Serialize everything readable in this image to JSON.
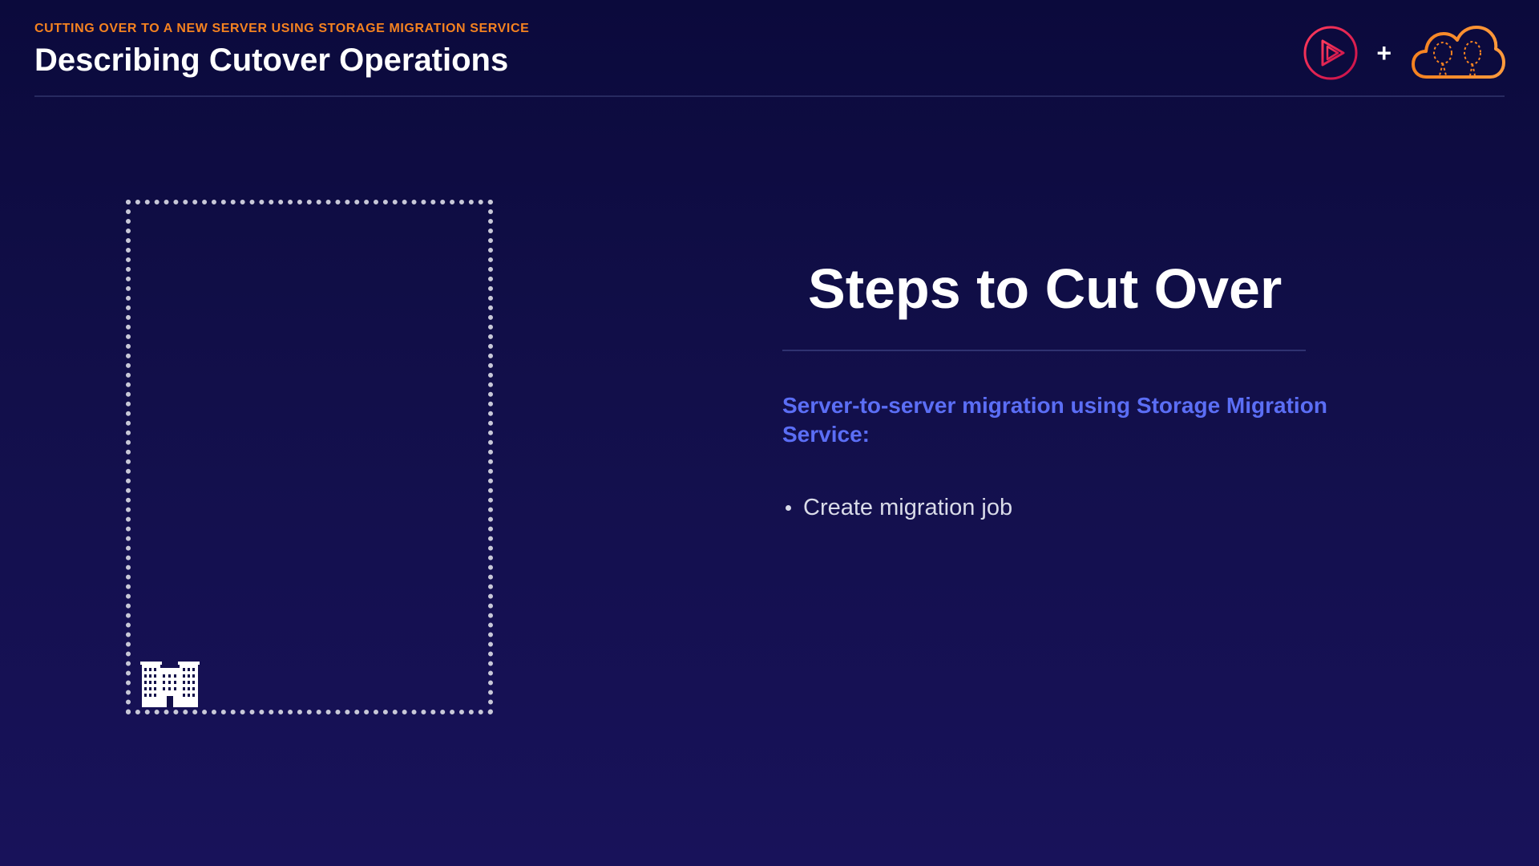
{
  "header": {
    "kicker": "CUTTING OVER TO A NEW SERVER USING STORAGE MIGRATION SERVICE",
    "title": "Describing Cutover Operations"
  },
  "brand": {
    "left_logo": "play-circle-icon",
    "plus": "+",
    "right_logo": "cloud-icon"
  },
  "diagram": {
    "placeholder": "dotted-rectangle",
    "icon": "building-icon"
  },
  "content": {
    "heading": "Steps to Cut Over",
    "subheading": "Server-to-server migration using Storage Migration Service:",
    "bullets": [
      "Create migration job"
    ]
  },
  "colors": {
    "accent_orange": "#f58220",
    "accent_blue": "#5b6ef5",
    "brand_red": "#e0174e",
    "background_top": "#0b0a3c",
    "background_bottom": "#18125a"
  }
}
